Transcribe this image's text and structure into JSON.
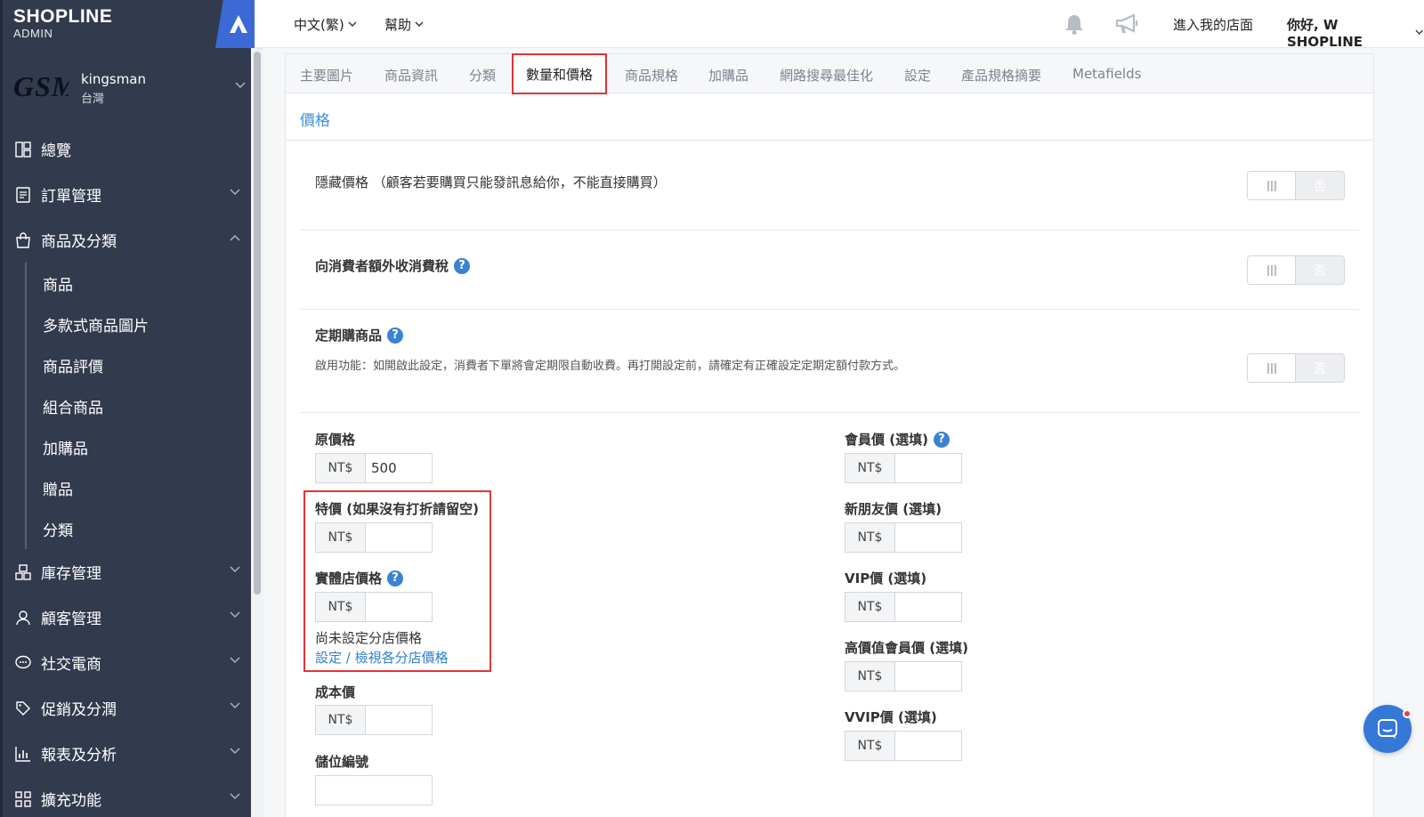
{
  "brand": {
    "name": "SHOPLINE",
    "sub": "ADMIN"
  },
  "store": {
    "logo": "GSM",
    "name": "kingsman",
    "region": "台灣"
  },
  "nav": {
    "overview": "總覽",
    "orders": "訂單管理",
    "products": "商品及分類",
    "sub_items": [
      "商品",
      "多款式商品圖片",
      "商品評價",
      "組合商品",
      "加購品",
      "贈品",
      "分類"
    ],
    "inventory": "庫存管理",
    "customers": "顧客管理",
    "social": "社交電商",
    "promotions": "促銷及分潤",
    "reports": "報表及分析",
    "extensions": "擴充功能"
  },
  "topbar": {
    "language": "中文(繁)",
    "help": "幫助",
    "visit_store": "進入我的店面",
    "greeting": "你好, W SHOPLINE",
    "icons": [
      "bell-icon",
      "megaphone-icon"
    ]
  },
  "tabs": [
    "主要圖片",
    "商品資訊",
    "分類",
    "數量和價格",
    "商品規格",
    "加購品",
    "網路搜尋最佳化",
    "設定",
    "產品規格摘要",
    "Metafields"
  ],
  "active_tab": "數量和價格",
  "section": {
    "title": "價格"
  },
  "settings": {
    "hide_price": {
      "label": "隱藏價格 （顧客若要購買只能發訊息給你，不能直接購買）",
      "toggle_off": "否"
    },
    "tax": {
      "label": "向消費者額外收消費稅",
      "toggle_off": "否"
    },
    "subscription": {
      "label": "定期購商品",
      "desc": "啟用功能：如開啟此設定，消費者下單將會定期限自動收費。再打開設定前，請確定有正確設定定期定額付款方式。",
      "toggle_off": "否"
    }
  },
  "prices": {
    "currency": "NT$",
    "original": {
      "label": "原價格",
      "value": "500"
    },
    "sale": {
      "label": "特價 (如果沒有打折請留空)",
      "value": ""
    },
    "retail": {
      "label": "實體店價格",
      "value": "",
      "note": "尚未設定分店價格",
      "link": "設定 / 檢視各分店價格"
    },
    "cost": {
      "label": "成本價",
      "value": ""
    },
    "sku": {
      "label": "儲位編號"
    },
    "member": {
      "label": "會員價 (選填)",
      "value": ""
    },
    "new_friend": {
      "label": "新朋友價 (選填)",
      "value": ""
    },
    "vip": {
      "label": "VIP價 (選填)",
      "value": ""
    },
    "high_value": {
      "label": "高價值會員價 (選填)",
      "value": ""
    },
    "vvip": {
      "label": "VVIP價 (選填)",
      "value": ""
    }
  },
  "colors": {
    "sidebar": "#323a4d",
    "accent": "#3a82d4",
    "highlight": "#e03535"
  }
}
